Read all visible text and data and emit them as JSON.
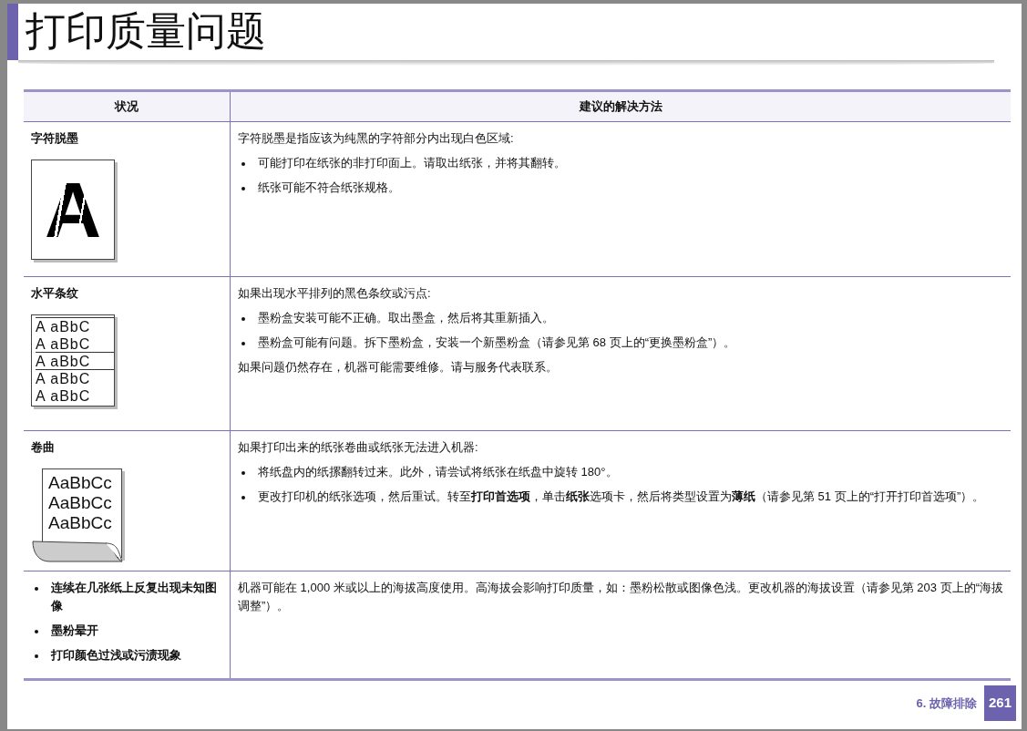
{
  "page_title": "打印质量问题",
  "table": {
    "columns": [
      "状况",
      "建议的解决方法"
    ],
    "rows": [
      {
        "condition": {
          "kind": "titled",
          "title": "字符脱墨",
          "illustration": {
            "kind": "faded-letter",
            "letter": "A"
          }
        },
        "solution": [
          {
            "kind": "para",
            "text": "字符脱墨是指应该为纯黑的字符部分内出现白色区域:"
          },
          {
            "kind": "bullet",
            "text": "可能打印在纸张的非打印面上。请取出纸张，并将其翻转。"
          },
          {
            "kind": "bullet",
            "text": "纸张可能不符合纸张规格。"
          }
        ]
      },
      {
        "condition": {
          "kind": "titled",
          "title": "水平条纹",
          "illustration": {
            "kind": "streaks",
            "lines": [
              {
                "text": "A aBbC",
                "streak": true
              },
              {
                "text": "A aBbC",
                "streak": false
              },
              {
                "text": "A aBbC",
                "streak": true
              },
              {
                "text": "A aBbC",
                "streak": true
              },
              {
                "text": "A aBbC",
                "streak": false
              }
            ]
          }
        },
        "solution": [
          {
            "kind": "para",
            "text": "如果出现水平排列的黑色条纹或污点:"
          },
          {
            "kind": "bullet",
            "text": "墨粉盒安装可能不正确。取出墨盒，然后将其重新插入。"
          },
          {
            "kind": "bullet",
            "text": "墨粉盒可能有问题。拆下墨粉盒，安装一个新墨粉盒（请参见第 68 页上的“更换墨粉盒”）。"
          },
          {
            "kind": "para",
            "text": "如果问题仍然存在，机器可能需要维修。请与服务代表联系。"
          }
        ]
      },
      {
        "condition": {
          "kind": "titled",
          "title": "卷曲",
          "illustration": {
            "kind": "curl",
            "lines": [
              "AaBbCc",
              "AaBbCc",
              "AaBbCc"
            ]
          }
        },
        "solution": [
          {
            "kind": "para",
            "text": "如果打印出来的纸张卷曲或纸张无法进入机器:"
          },
          {
            "kind": "bullet",
            "text": "将纸盘内的纸摞翻转过来。此外，请尝试将纸张在纸盘中旋转 180°。"
          },
          {
            "kind": "bullet",
            "text": "更改打印机的纸张选项，然后重试。转至**打印首选项**，单击**纸张**选项卡，然后将类型设置为**薄纸**（请参见第 51 页上的“打开打印首选项”）。"
          }
        ]
      },
      {
        "condition": {
          "kind": "bullets",
          "items": [
            "连续在几张纸上反复出现未知图像",
            "墨粉晕开",
            "打印颜色过浅或污渍现象"
          ]
        },
        "solution": [
          {
            "kind": "para",
            "text": "机器可能在 1,000 米或以上的海拔高度使用。高海拔会影响打印质量，如：墨粉松散或图像色浅。更改机器的海拔设置（请参见第 203 页上的“海拔调整”）。"
          }
        ]
      }
    ]
  },
  "footer": {
    "section": "6.  故障排除",
    "page_number": "261"
  }
}
